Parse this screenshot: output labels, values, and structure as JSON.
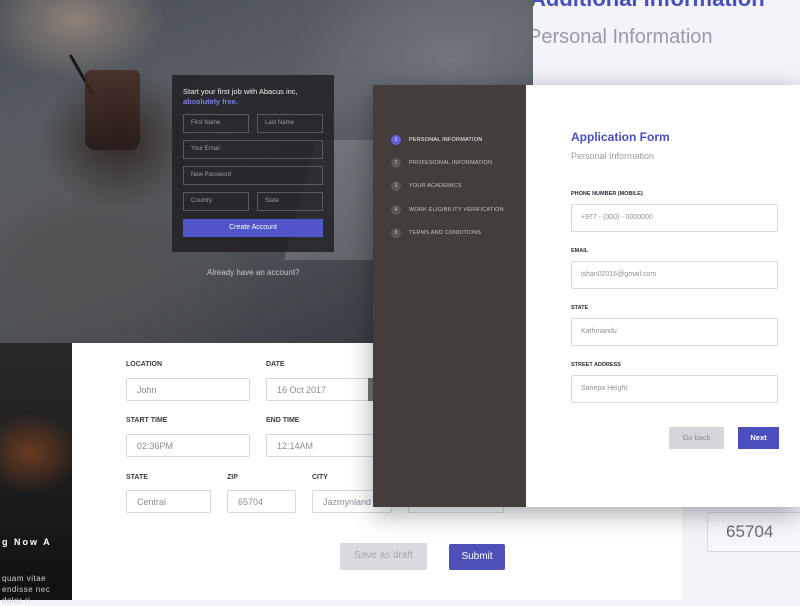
{
  "back_panel": {
    "title": "Additional Information",
    "subtitle": "Personal Information",
    "zip_value": "65704"
  },
  "signup": {
    "heading": "Start your first job with Abacus inc,",
    "heading_highlight": "absolutely free.",
    "first_name_placeholder": "First Name",
    "last_name_placeholder": "Last Name",
    "email_placeholder": "Your Email",
    "password_placeholder": "New Password",
    "country_placeholder": "Country",
    "state_placeholder": "State",
    "create_button": "Create Account",
    "already_link": "Already have an account?"
  },
  "photo_bottom": {
    "headline": "g Now A",
    "para_line1": "quam vitae",
    "para_line2": "endisse nec",
    "para_line3": "dolor ri"
  },
  "event_form": {
    "location_label": "LOCATION",
    "location_value": "John",
    "date_label": "DATE",
    "date_value": "16 Oct 2017",
    "start_time_label": "START TIME",
    "start_time_value": "02:36PM",
    "end_time_label": "END TIME",
    "end_time_value": "12:14AM",
    "state_label": "STATE",
    "state_value": "Central",
    "zip_label": "ZIP",
    "zip_value": "65704",
    "city_label": "CITY",
    "city_value": "Jazmynland",
    "draft_button": "Save as draft",
    "submit_button": "Submit"
  },
  "steps": [
    {
      "num": "1",
      "label": "PERSONAL INFORMATION",
      "active": true
    },
    {
      "num": "2",
      "label": "PROFESIONAL INFORMATION",
      "active": false
    },
    {
      "num": "3",
      "label": "YOUR ACADEMICS",
      "active": false
    },
    {
      "num": "4",
      "label": "WORK ELIGIBILITY VERIFICATION",
      "active": false
    },
    {
      "num": "5",
      "label": "TERMS AND CONDITIONS",
      "active": false
    }
  ],
  "app_form": {
    "title": "Application Form",
    "subtitle": "Personal Information",
    "phone_label": "PHONE NUMBER (MOBILE)",
    "phone_value": "+977 - (000) - 0000000",
    "email_label": "EMAIL",
    "email_value": "ishan02016@gmail.com",
    "state_label": "STATE",
    "state_value": "Kathmandu",
    "street_label": "STREET ADDRESS",
    "street_value": "Sanepa Height",
    "goback_button": "Go back",
    "next_button": "Next"
  },
  "colors": {
    "accent": "#4a4fb8",
    "sidebar_bg": "#433e3c",
    "active_step": "#5f62d6"
  }
}
